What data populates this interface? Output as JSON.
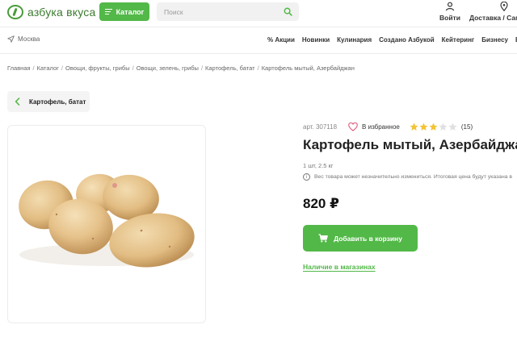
{
  "header": {
    "logo_text": "азбука вкуса",
    "catalog_label": "Каталог",
    "search_placeholder": "Поиск",
    "login_label": "Войти",
    "delivery_label": "Доставка / Сам"
  },
  "nav": {
    "city": "Москва",
    "links": [
      "% Акции",
      "Новинки",
      "Кулинария",
      "Создано Азбукой",
      "Кейтеринг",
      "Бизнесу",
      "В г"
    ]
  },
  "breadcrumbs": [
    "Главная",
    "Каталог",
    "Овощи, фрукты, грибы",
    "Овощи, зелень, грибы",
    "Картофель, батат",
    "Картофель мытый, Азербайджан"
  ],
  "back_button": {
    "label": "Картофель, батат"
  },
  "product": {
    "article": "арт. 307118",
    "favorite_label": "В избранное",
    "rating": 3,
    "rating_max": 5,
    "reviews": "(15)",
    "title": "Картофель мытый, Азербайджан",
    "weight": "1 шт, 2.5 кг",
    "notice": "Вес товара может незначительно измениться. Итоговая цена будут указана в",
    "price": "820 ₽",
    "add_to_cart_label": "Добавить в корзину",
    "stores_link": "Наличие в магазинах"
  },
  "colors": {
    "accent": "#52b848",
    "star_filled": "#f2c335",
    "star_empty": "#e0e0e0",
    "heart": "#e0567a"
  }
}
